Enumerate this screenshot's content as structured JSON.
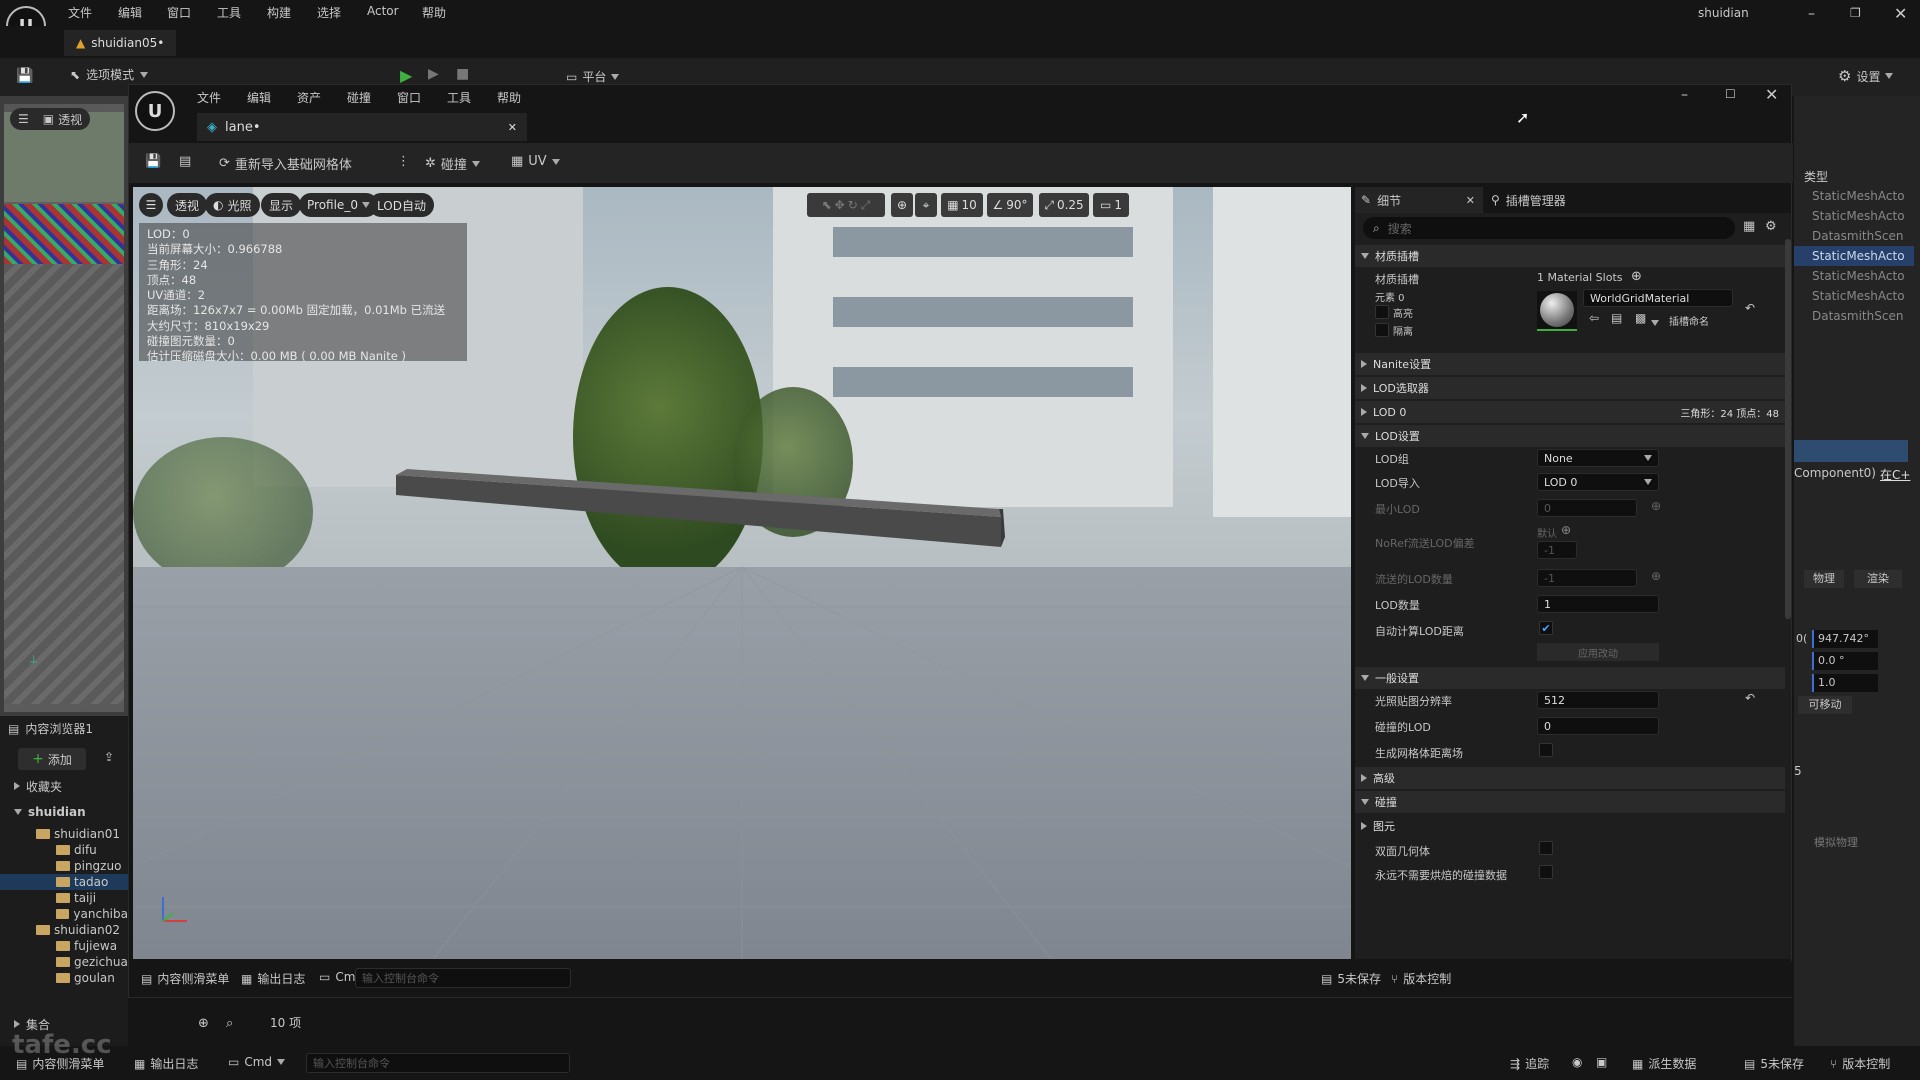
{
  "outer": {
    "menu": [
      "文件",
      "编辑",
      "窗口",
      "工具",
      "构建",
      "选择",
      "Actor",
      "帮助"
    ],
    "user": "shuidian",
    "tab_label": "shuidian05•",
    "toolbar": {
      "mode_label": "选项模式",
      "platform_label": "平台",
      "settings_label": "设置"
    },
    "left_viewport": {
      "view_label": "透视"
    },
    "content_browser": {
      "title": "内容浏览器1",
      "add_label": "添加",
      "favorites_label": "收藏夹",
      "root_label": "shuidian",
      "folders": [
        "shuidian01",
        "difu",
        "pingzuo",
        "tadao",
        "taiji",
        "yanchiba",
        "shuidian02",
        "fujiewa",
        "gezichua",
        "goulan"
      ],
      "collections_label": "集合",
      "item_count": "10 项"
    },
    "right_panel": {
      "type_header": "类型",
      "items": [
        "StaticMeshActo",
        "StaticMeshActo",
        "DatasmithScen",
        "StaticMeshActo",
        "StaticMeshActo",
        "StaticMeshActo",
        "DatasmithScen"
      ],
      "component_text": "Component0)",
      "component_link": "在C+",
      "tabs": [
        "物理",
        "渲染"
      ],
      "values": [
        "947.742°",
        "0.0 °",
        "1.0"
      ],
      "movable_label": "可移动",
      "partial_zero": "0(",
      "digit": "5",
      "sim_physics_label": "模拟物理"
    },
    "bottom": {
      "drawer_label": "内容侧滑菜单",
      "log_label": "输出日志",
      "cmd_label": "Cmd",
      "cmd_placeholder": "输入控制台命令",
      "trace_label": "追踪",
      "derived_label": "派生数据",
      "unsaved_label": "5未保存",
      "source_label": "版本控制"
    },
    "watermark": "tafe.cc"
  },
  "inner": {
    "menu": [
      "文件",
      "编辑",
      "资产",
      "碰撞",
      "窗口",
      "工具",
      "帮助"
    ],
    "tab_label": "lane•",
    "toolbar": {
      "reimport_label": "重新导入基础网格体",
      "collision_label": "碰撞",
      "uv_label": "UV"
    },
    "viewport": {
      "buttons": {
        "view_label": "透视",
        "lit_label": "光照",
        "show_label": "显示",
        "profile_label": "Profile_0",
        "lod_label": "LOD自动"
      },
      "tools": {
        "grid_value": "10",
        "angle_value": "90°",
        "scale_value": "0.25",
        "camera_value": "1"
      },
      "stats": [
        "LOD：0",
        "当前屏幕大小：0.966788",
        "三角形：24",
        "顶点：48",
        "UV通道：2",
        "距离场：126x7x7 = 0.00Mb 固定加载，0.01Mb 已流送",
        "大约尺寸：810x19x29",
        "碰撞图元数量：0",
        "估计压缩磁盘大小：0.00 MB ( 0.00 MB Nanite )"
      ]
    },
    "details": {
      "tab_details": "细节",
      "tab_sockets": "插槽管理器",
      "search_placeholder": "搜索",
      "sections": {
        "material_slots": "材质插槽",
        "nanite": "Nanite设置",
        "lod_picker": "LOD选取器",
        "lod0": "LOD 0",
        "lod_settings": "LOD设置",
        "general": "一般设置",
        "advanced": "高级",
        "collision": "碰撞",
        "primitive": "图元"
      },
      "material": {
        "label": "材质插槽",
        "slots_count": "1 Material Slots",
        "element_label": "元素 0",
        "highlight_label": "高亮",
        "isolate_label": "隔离",
        "material_name": "WorldGridMaterial",
        "slot_name_label": "插槽命名"
      },
      "lod0_info": "三角形：24    顶点：48",
      "lod_settings": {
        "lod_group_label": "LOD组",
        "lod_group_value": "None",
        "lod_import_label": "LOD导入",
        "lod_import_value": "LOD 0",
        "min_lod_label": "最小LOD",
        "min_lod_value": "0",
        "noref_label": "NoRef流送LOD偏差",
        "noref_default": "默认",
        "noref_value": "-1",
        "streamed_label": "流送的LOD数量",
        "streamed_value": "-1",
        "count_label": "LOD数量",
        "count_value": "1",
        "auto_label": "自动计算LOD距离",
        "apply_label": "应用改动"
      },
      "general": {
        "lightmap_label": "光照贴图分辨率",
        "lightmap_value": "512",
        "collision_lod_label": "碰撞的LOD",
        "collision_lod_value": "0",
        "distance_field_label": "生成网格体距离场"
      },
      "primitive": {
        "double_sided_label": "双面几何体",
        "never_cook_label": "永远不需要烘焙的碰撞数据"
      }
    },
    "bottom": {
      "drawer_label": "内容侧滑菜单",
      "log_label": "输出日志",
      "cmd_label": "Cmd",
      "cmd_placeholder": "输入控制台命令",
      "unsaved_label": "5未保存",
      "source_label": "版本控制"
    }
  }
}
